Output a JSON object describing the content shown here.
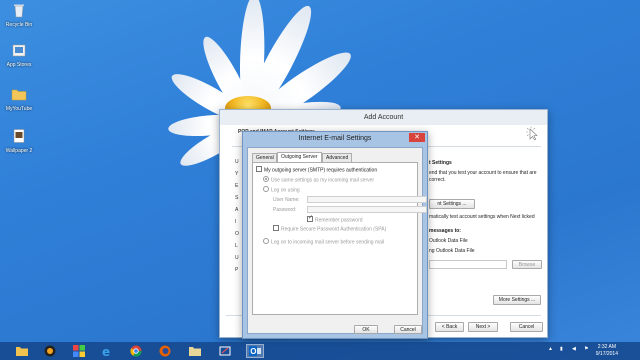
{
  "desktop": {
    "icons": [
      {
        "label": "Recycle Bin",
        "icon": "recycle-bin-icon"
      },
      {
        "label": "App Stores",
        "icon": "app-stores-icon"
      },
      {
        "label": "MyYouTube",
        "icon": "youtube-folder-icon"
      },
      {
        "label": "Wallpaper 2",
        "icon": "wallpaper-file-icon"
      }
    ]
  },
  "add_account": {
    "title": "Add Account",
    "heading": "POP and IMAP Account Settings",
    "left_ghost_letters": [
      "U",
      "Y",
      "E",
      "S",
      "A",
      "I",
      "O",
      "L",
      "U",
      "P"
    ],
    "test_heading": "t Settings",
    "test_text": "end that you test your account to ensure that are correct.",
    "test_button": "nt Settings ...",
    "auto_test_text": "matically test account settings when Next licked",
    "deliver_heading": "messages to:",
    "radio_1": "Outlook Data File",
    "radio_2": "ng Outlook Data File",
    "browse_button": "Browse",
    "more_settings_button": "More Settings ...",
    "back_button": "< Back",
    "next_button": "Next >",
    "cancel_button": "Cancel"
  },
  "email_settings": {
    "title": "Internet E-mail Settings",
    "close_glyph": "✕",
    "tabs": [
      {
        "label": "General",
        "active": false
      },
      {
        "label": "Outgoing Server",
        "active": true
      },
      {
        "label": "Advanced",
        "active": false
      }
    ],
    "smtp_auth_checkbox": "My outgoing server (SMTP) requires authentication",
    "same_settings_radio": "Use same settings as my incoming mail server",
    "log_on_using_radio": "Log on using",
    "user_name_label": "User Name:",
    "password_label": "Password:",
    "remember_password": "Remember password",
    "spa_checkbox": "Require Secure Password Authentication (SPA)",
    "log_on_incoming_radio": "Log on to incoming mail server before sending mail",
    "ok_button": "OK",
    "cancel_button": "Cancel"
  },
  "taskbar": {
    "apps": [
      "file-explorer-icon",
      "media-player-icon",
      "tiles-app-icon",
      "internet-explorer-icon",
      "chrome-icon",
      "firefox-icon",
      "folder-icon",
      "snipping-tool-icon",
      "outlook-icon"
    ],
    "time": "2:32 AM",
    "date": "9/17/2014"
  }
}
